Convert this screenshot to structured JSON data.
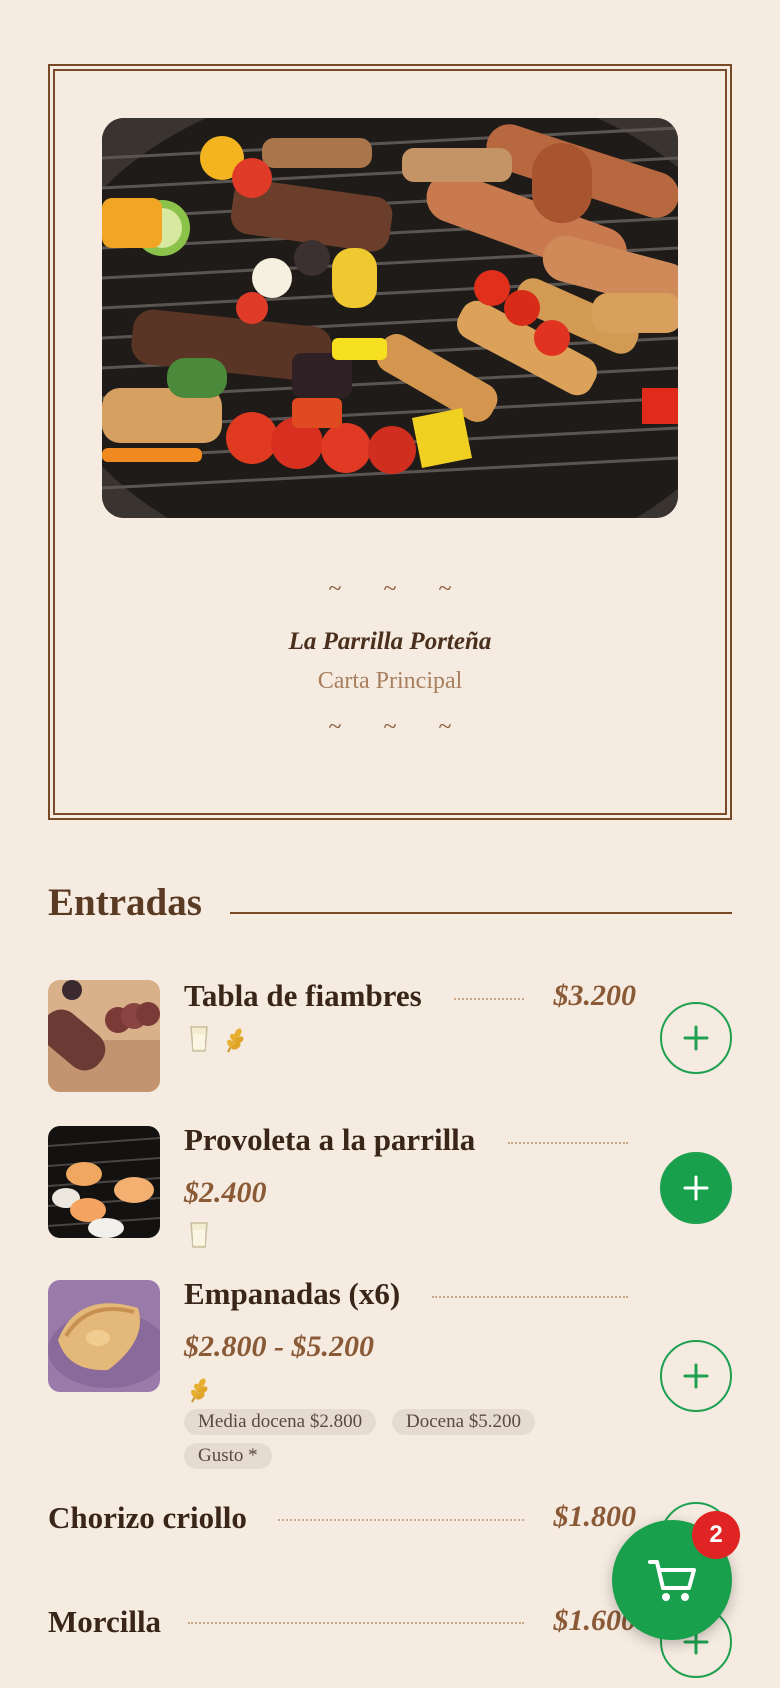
{
  "restaurant": {
    "ornament": "~ ~ ~",
    "name": "La Parrilla Porteña",
    "subtitle": "Carta Principal"
  },
  "section": {
    "title": "Entradas"
  },
  "items": [
    {
      "name": "Tabla de fiambres",
      "price": "$3.200",
      "icons": [
        "milk-icon",
        "wheat-icon"
      ]
    },
    {
      "name": "Provoleta a la parrilla",
      "price": "$2.400",
      "icons": [
        "milk-icon"
      ]
    },
    {
      "name": "Empanadas (x6)",
      "price": "$2.800 - $5.200",
      "icons": [
        "wheat-icon"
      ],
      "options": [
        "Media docena $2.800",
        "Docena $5.200",
        "Gusto *"
      ]
    },
    {
      "name": "Chorizo criollo",
      "price": "$1.800"
    },
    {
      "name": "Morcilla",
      "price": "$1.600"
    }
  ],
  "cart": {
    "count": "2",
    "icon": "cart-icon"
  },
  "colors": {
    "accent": "#19a04c",
    "brown": "#7a4a26",
    "badge": "#e02424",
    "background": "#f5ebe1"
  }
}
